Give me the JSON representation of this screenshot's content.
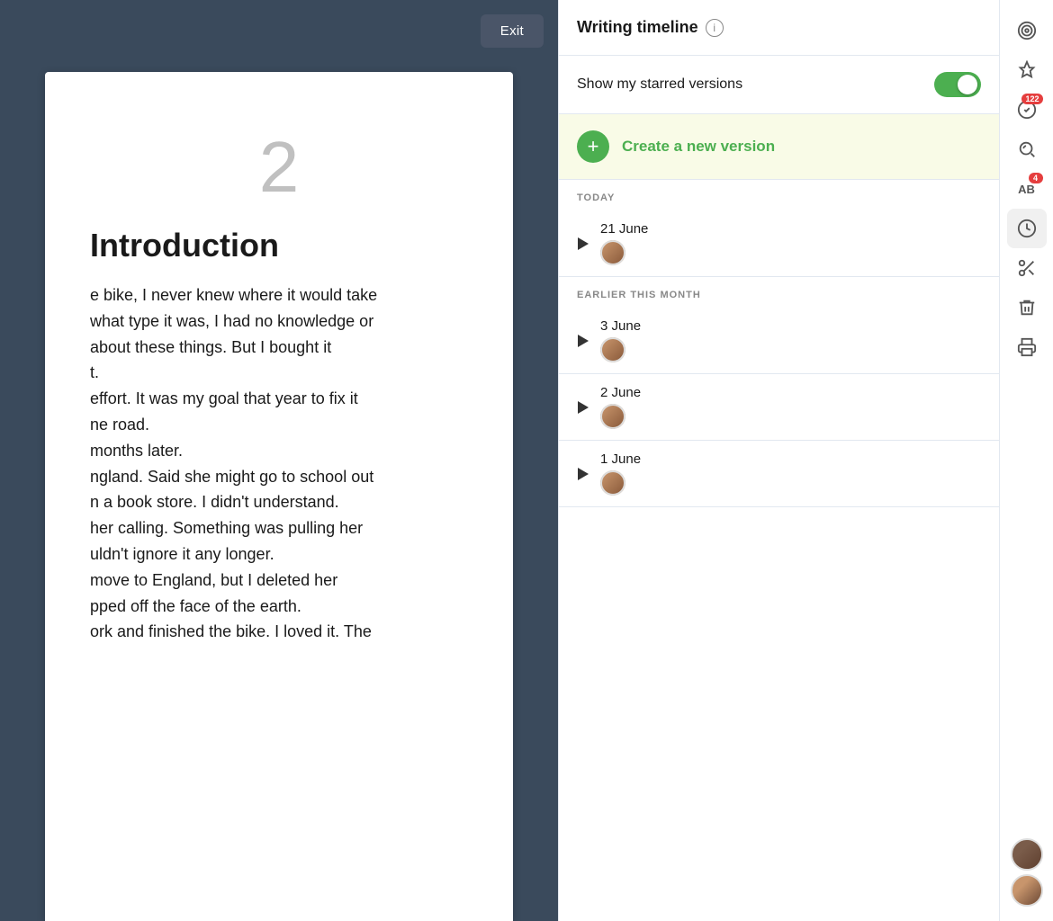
{
  "editor": {
    "exit_button_label": "Exit",
    "page_number": "2",
    "page_title": "Introduction",
    "page_text_lines": [
      "e bike, I never knew where it would take",
      "what type it was, I had no knowledge or",
      "about these things. But I bought it",
      "t.",
      "effort. It was my goal that year to fix it",
      "ne road.",
      "months later.",
      "ngland. Said she might go to school out",
      "n a book store. I didn't understand.",
      "her calling. Something was pulling her",
      "uldn't ignore it any longer.",
      "move to England, but I deleted her",
      "pped off the face of the earth.",
      "ork and finished the bike. I loved it. The"
    ]
  },
  "timeline": {
    "title": "Writing timeline",
    "info_icon_label": "i",
    "starred_label": "Show my starred versions",
    "toggle_on": true,
    "create_version_label": "Create a new version",
    "sections": [
      {
        "name": "TODAY",
        "entries": [
          {
            "date": "21 June",
            "avatar_color": "#c8956c"
          }
        ]
      },
      {
        "name": "EARLIER THIS MONTH",
        "entries": [
          {
            "date": "3 June",
            "avatar_color": "#c8956c"
          },
          {
            "date": "2 June",
            "avatar_color": "#c8956c"
          },
          {
            "date": "1 June",
            "avatar_color": "#c8956c"
          }
        ]
      }
    ]
  },
  "right_sidebar": {
    "icons": [
      {
        "name": "target-icon",
        "symbol": "🎯",
        "badge": null
      },
      {
        "name": "pin-icon",
        "symbol": "📌",
        "badge": null
      },
      {
        "name": "check-badge-icon",
        "symbol": "✅",
        "badge": "122"
      },
      {
        "name": "search-refresh-icon",
        "symbol": "🔍",
        "badge": null
      },
      {
        "name": "abc-icon",
        "symbol": "AB",
        "badge": "4"
      },
      {
        "name": "clock-icon",
        "symbol": "🕐",
        "badge": null,
        "active": true
      },
      {
        "name": "scissors-icon",
        "symbol": "✂️",
        "badge": null
      },
      {
        "name": "trash-icon",
        "symbol": "🗑",
        "badge": null
      },
      {
        "name": "print-icon",
        "symbol": "🖨",
        "badge": null
      }
    ],
    "avatars": [
      {
        "name": "user-avatar-1",
        "color": "#7a5c4a"
      },
      {
        "name": "user-avatar-2",
        "color": "#c8956c"
      }
    ]
  }
}
